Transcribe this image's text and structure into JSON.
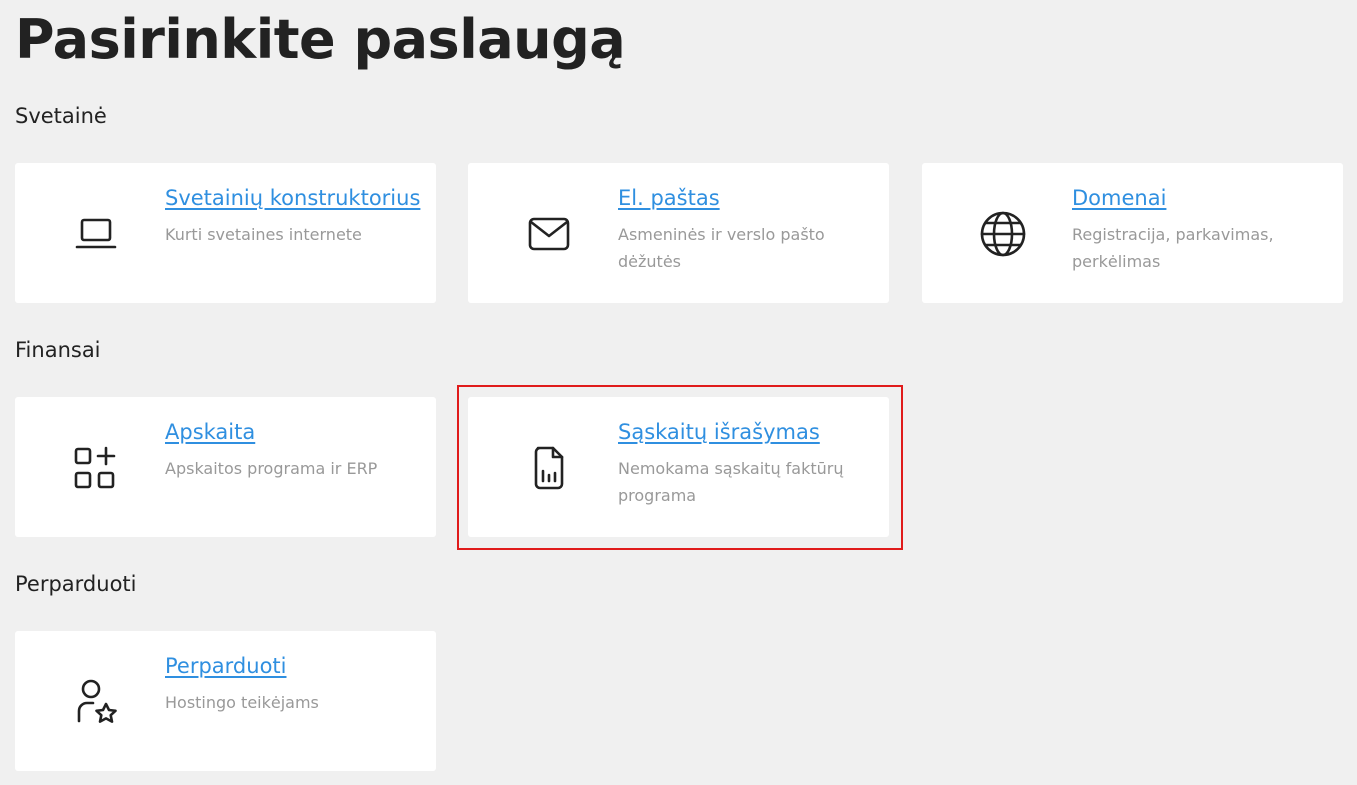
{
  "page": {
    "title": "Pasirinkite paslaugą"
  },
  "sections": [
    {
      "title": "Svetainė",
      "cards": [
        {
          "title": "Svetainių konstruktorius",
          "description": "Kurti svetaines internete",
          "icon": "laptop-icon"
        },
        {
          "title": "El. paštas",
          "description": "Asmeninės ir verslo pašto dėžutės",
          "icon": "envelope-icon"
        },
        {
          "title": "Domenai",
          "description": "Registracija, parkavimas, perkėlimas",
          "icon": "globe-icon"
        }
      ]
    },
    {
      "title": "Finansai",
      "cards": [
        {
          "title": "Apskaita",
          "description": "Apskaitos programa ir ERP",
          "icon": "apps-add-icon"
        },
        {
          "title": "Sąskaitų išrašymas",
          "description": "Nemokama sąskaitų faktūrų programa",
          "icon": "invoice-chart-icon",
          "highlighted": true
        }
      ]
    },
    {
      "title": "Perparduoti",
      "cards": [
        {
          "title": "Perparduoti",
          "description": "Hostingo teikėjams",
          "icon": "user-star-icon"
        }
      ]
    }
  ],
  "colors": {
    "background": "#f0f0f0",
    "card": "#ffffff",
    "link": "#2f8fe0",
    "description": "#999999",
    "highlight": "#e01b1b"
  }
}
